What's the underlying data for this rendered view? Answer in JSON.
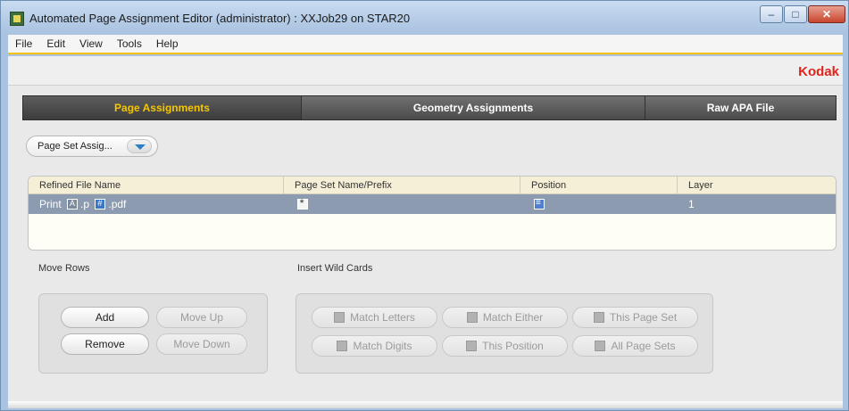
{
  "window": {
    "title": "Automated Page Assignment Editor (administrator) : XXJob29 on STAR20",
    "controls": {
      "minimize": "–",
      "maximize": "□",
      "close": "✕"
    }
  },
  "menu": [
    "File",
    "Edit",
    "View",
    "Tools",
    "Help"
  ],
  "brand": {
    "name": "Kodak",
    "color": "#e0241c"
  },
  "tabs": [
    {
      "label": "Page Assignments",
      "active": true
    },
    {
      "label": "Geometry Assignments",
      "active": false
    },
    {
      "label": "Raw APA File",
      "active": false
    }
  ],
  "dropdown": {
    "value": "Page Set Assig..."
  },
  "table": {
    "headers": [
      "Refined File Name",
      "Page Set Name/Prefix",
      "Position",
      "Layer"
    ],
    "rows": [
      {
        "file_prefix": "Print ",
        "file_mid": ".p ",
        "file_suffix": ".pdf",
        "layer": "1"
      }
    ]
  },
  "move_rows": {
    "label": "Move Rows",
    "add": "Add",
    "move_up": "Move Up",
    "remove": "Remove",
    "move_down": "Move Down"
  },
  "wild_cards": {
    "label": "Insert Wild Cards",
    "match_letters": "Match Letters",
    "match_either": "Match Either",
    "this_page_set": "This Page Set",
    "match_digits": "Match Digits",
    "this_position": "This Position",
    "all_page_sets": "All Page Sets"
  },
  "colors": {
    "selected_row": "#8c9bb0",
    "active_tab_text": "#f6c700",
    "menu_accent": "#f2c200"
  }
}
